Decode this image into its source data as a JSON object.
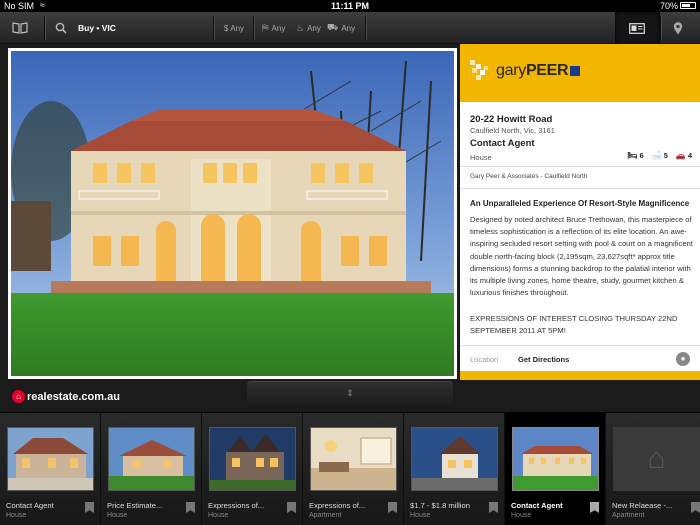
{
  "status": {
    "carrier": "No SIM",
    "time": "11:11 PM",
    "battery": "70%",
    "battery_level": 0.7
  },
  "toolbar": {
    "search_mode": "Buy • VIC",
    "price_filter": "$ Any",
    "bed_filter": "Any",
    "bath_filter": "Any",
    "car_filter": "Any"
  },
  "listing": {
    "address": "20-22 Howitt Road",
    "suburb": "Caulfield North, Vic, 3161",
    "price": "Contact Agent",
    "property_type": "House",
    "beds": "6",
    "baths": "5",
    "cars": "4",
    "agency": "Gary Peer & Associates - Caulfield North",
    "headline": "An Unparalleled Experience Of Resort-Style Magnificence",
    "description": "Designed by noted architect Bruce Trethowan, this masterpiece of timeless sophistication is a reflection of its elite location. An awe-inspiring secluded resort setting with pool & court on a magnificent double north-facing block (2,195sqm, 23,627sqft* approx title dimensions) forms a stunning backdrop to the palatial interior with its multiple living zones, home theatre, study, gourmet kitchen & luxurious finishes throughout.",
    "closing": "EXPRESSIONS OF INTEREST CLOSING THURSDAY 22ND SEPTEMBER 2011 AT 5PM!",
    "location_label": "Location",
    "directions_label": "Get Directions"
  },
  "brand": {
    "agency_logo_light": "gary",
    "agency_logo_bold": "PEER",
    "portal": "realestate.com.au",
    "accent": "#f2b500"
  },
  "carousel": [
    {
      "title": "Contact Agent",
      "type": "House"
    },
    {
      "title": "Price Estimate...",
      "type": "House"
    },
    {
      "title": "Expressions of...",
      "type": "House"
    },
    {
      "title": "Expressions of...",
      "type": "Apartment"
    },
    {
      "title": "$1.7 - $1.8 million",
      "type": "House"
    },
    {
      "title": "Contact Agent",
      "type": "House"
    },
    {
      "title": "New Relaease -...",
      "type": "Apartment"
    }
  ]
}
